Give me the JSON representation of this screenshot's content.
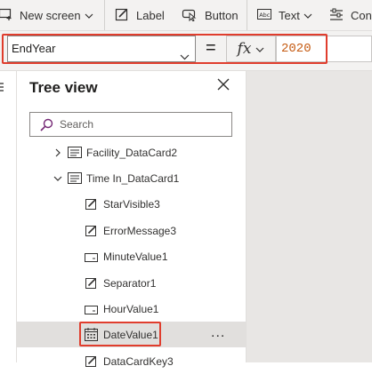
{
  "toolbar": {
    "new_screen": "New screen",
    "label": "Label",
    "button": "Button",
    "text": "Text",
    "controls": "Con"
  },
  "formula_bar": {
    "property": "EndYear",
    "equals": "=",
    "fx": "fx",
    "value": "2020"
  },
  "tree_view": {
    "title": "Tree view",
    "search_placeholder": "Search",
    "items": [
      {
        "label": "Facility_DataCard2",
        "icon": "datacard-icon",
        "expanded": false
      },
      {
        "label": "Time In_DataCard1",
        "icon": "datacard-icon",
        "expanded": true
      },
      {
        "label": "StarVisible3",
        "icon": "edit-label-icon"
      },
      {
        "label": "ErrorMessage3",
        "icon": "edit-label-icon"
      },
      {
        "label": "MinuteValue1",
        "icon": "dropdown-control-icon"
      },
      {
        "label": "Separator1",
        "icon": "edit-label-icon"
      },
      {
        "label": "HourValue1",
        "icon": "dropdown-control-icon"
      },
      {
        "label": "DateValue1",
        "icon": "calendar-icon",
        "selected": true
      },
      {
        "label": "DataCardKey3",
        "icon": "edit-label-icon"
      }
    ],
    "more": "..."
  },
  "colors": {
    "highlight": "#e03d2d",
    "formula_value": "#c55a11",
    "accent_purple": "#742774",
    "selected_row": "#e1dfdd"
  }
}
